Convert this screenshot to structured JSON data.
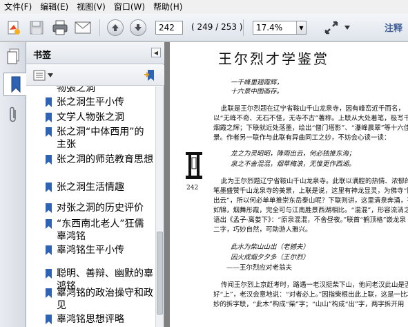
{
  "menu": [
    "文件(F)",
    "编辑(E)",
    "视图(V)",
    "窗口(W)",
    "帮助(H)"
  ],
  "toolbar": {
    "page_current": "242",
    "page_count": "( 249 / 253 )",
    "zoom": "17.4%",
    "annotate_label": "注释"
  },
  "bookmarks": {
    "title": "书签",
    "items": [
      {
        "label": "物張之洞"
      },
      {
        "label": "张之洞生平小传"
      },
      {
        "label": "文学人物张之洞"
      },
      {
        "label": "张之洞“中体西用”的主张"
      },
      {
        "label": "张之洞的师范教育思想"
      },
      {
        "label": "张之洞生活情趣"
      },
      {
        "label": "对张之洞的历史评价"
      },
      {
        "label": "“东西南北老人”狂儒辜鸿铭"
      },
      {
        "label": "辜鸿铭生平小传"
      },
      {
        "label": "聪明、善辩、幽默的辜鸿铭"
      },
      {
        "label": "辜鸿铭的政治操守和政见"
      },
      {
        "label": "辜鸿铭思想评略"
      }
    ]
  },
  "page": {
    "title": "王尔烈才学鉴赏",
    "page_number": "242",
    "lines": [
      "一千峰里翅霞辉，",
      "十六景中图画存。",
      "此联是王尔烈题在辽宁省鞍山千山龙泉寺，因有峰峦近千而名，",
      "以“无峰不奇、无石不怪，无寺不古”著称。上联从大处着笔，极写千峰",
      "烟霞之辉；下联就近处落墨，绘出“僧门塔影”、“瀑峰晨翠”等十六佳",
      "景。作者另一联作与此联有异曲同工之妙，不妨会心读一读：",
      "龙之为灵昭昭，降雨出云，何必独推东海；",
      "泉之不舍混混，烟草梅浪，无惟更作西湖。",
      "此为王尔烈题辽宁省鞍山千山龙泉寺。此联以满腔的热情、浓郁的",
      "笔墨盛赞千山龙泉寺的美景，上联是说，这里有神龙显灵，为佛寺“降雨",
      "出云”，所以何必单单推崇东岳泰山呢？下联则讲，这里清泉奔涌，花簇",
      "如锦，烟舞彤霞，完全可与江南胜景西湖相比。“混混”，形容流淌之声，",
      "语出《孟子·离娄下》：“原泉混混，不舍昼夜。”联首“鹤顶格”嵌龙泉",
      "二字，巧妙自然，可助游人雅兴。",
      "此水为柴山山出（老撼夫）",
      "因火成烟夕夕多（王尔烈）",
      "——王尔烈应对老翁夫",
      "传闻王尔烈上京赶考时，路遇一老汉挺柴下山，他问老汉此山是否",
      "好“上”，老汉会意地说：“对者必上。”因指柴根出此上联，这是一比巧",
      "妙的拆字联，“此木”构成“柴”字；“山山”构成“出”字，两字拆开用"
    ]
  },
  "colors": {
    "accent": "#3d5f96",
    "bookmark_icon": "#2f63b4"
  }
}
